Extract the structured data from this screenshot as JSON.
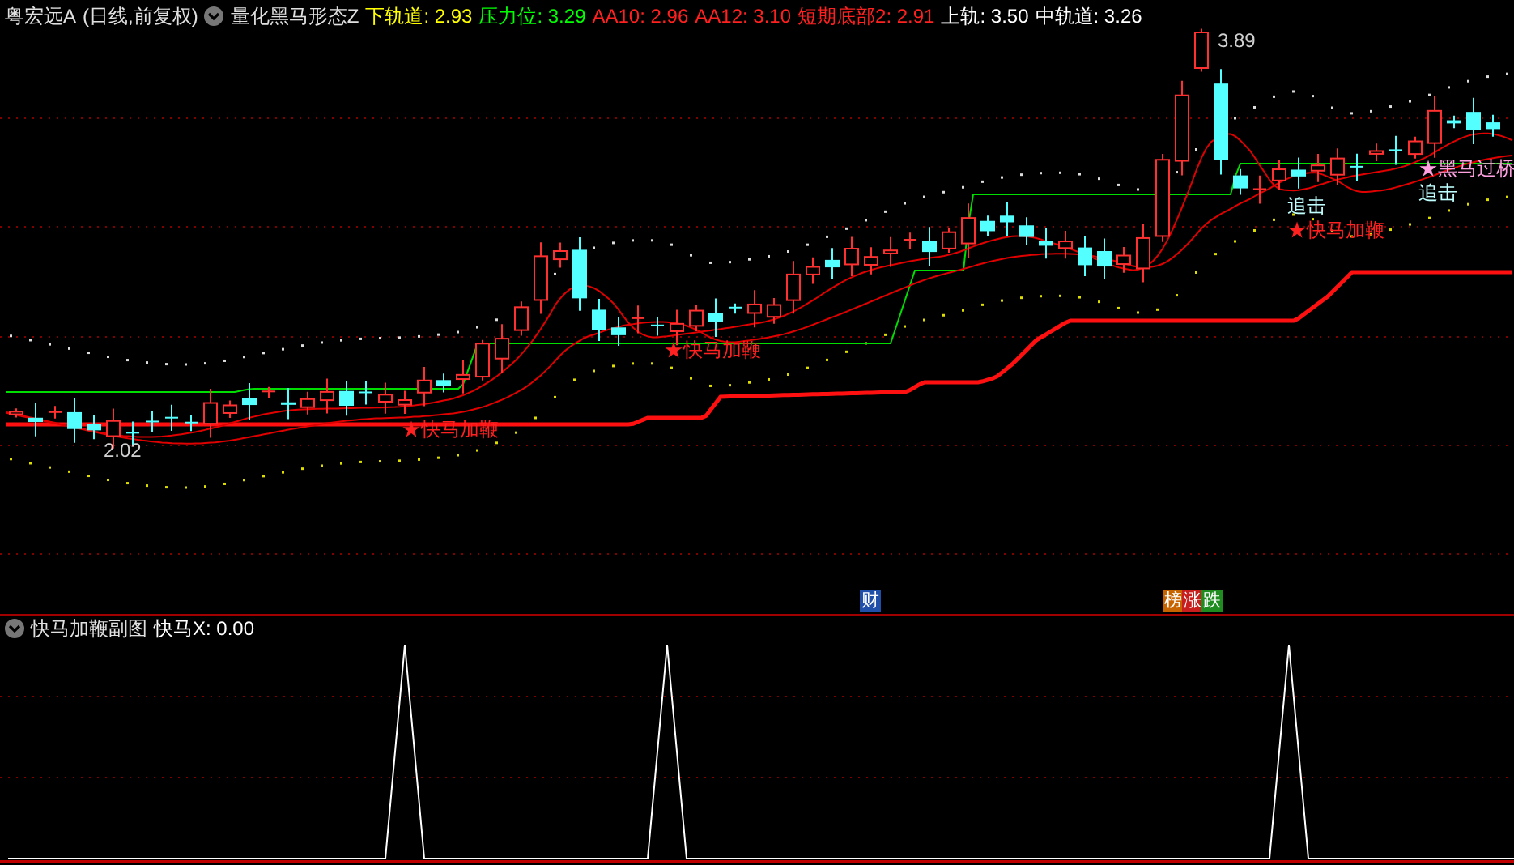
{
  "main_panel": {
    "stock": "粤宏远A",
    "period": "(日线,前复权)",
    "indicator": "量化黑马形态Z",
    "values": [
      {
        "label": "下轨道:",
        "value": "2.93",
        "color": "#ffff00"
      },
      {
        "label": "压力位:",
        "value": "3.29",
        "color": "#00ff00"
      },
      {
        "label": "AA10:",
        "value": "2.96",
        "color": "#ff2020"
      },
      {
        "label": "AA12:",
        "value": "3.10",
        "color": "#ff2020"
      },
      {
        "label": "短期底部2:",
        "value": "2.91",
        "color": "#ff2020"
      },
      {
        "label": "上轨:",
        "value": "3.50",
        "color": "#ffffff"
      },
      {
        "label": "中轨道:",
        "value": "3.26",
        "color": "#ffffff"
      }
    ],
    "annotations": [
      {
        "kind": "price",
        "text": "3.89"
      },
      {
        "kind": "price",
        "text": "2.02"
      },
      {
        "kind": "signal",
        "text": "★快马加鞭"
      },
      {
        "kind": "signal",
        "text": "★快马加鞭"
      },
      {
        "kind": "chase",
        "text": "追击"
      },
      {
        "kind": "signal",
        "text": "★快马加鞭"
      },
      {
        "kind": "bridge",
        "text": "★黑马过桥"
      },
      {
        "kind": "chase",
        "text": "追击"
      }
    ]
  },
  "markers": [
    {
      "text": "财",
      "color": "#1f4fa8"
    },
    {
      "text": "榜",
      "color": "#c86400"
    },
    {
      "text": "涨",
      "color": "#c81e1e"
    },
    {
      "text": "跌",
      "color": "#1e8c1e"
    }
  ],
  "sub_panel": {
    "indicator": "快马加鞭副图",
    "values": [
      {
        "label": "快马X:",
        "value": "0.00",
        "color": "#ffffff"
      }
    ]
  }
}
